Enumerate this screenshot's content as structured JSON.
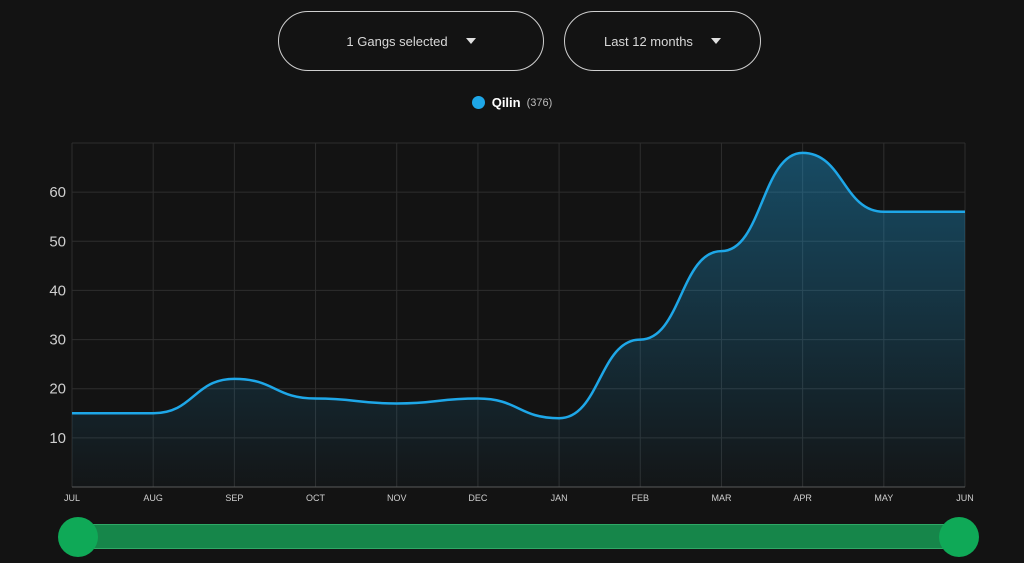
{
  "filters": {
    "gangs_label": "1 Gangs selected",
    "period_label": "Last 12 months"
  },
  "legend": {
    "name": "Qilin",
    "count": "(376)"
  },
  "colors": {
    "series": "#1ea7e8",
    "background": "#131313",
    "grid": "#2e2e2e",
    "slider": "#16864a",
    "slider_handle": "#0fa957"
  },
  "range_slider": {
    "start_fraction": 0,
    "end_fraction": 1
  },
  "chart_data": {
    "type": "area",
    "title": "",
    "xlabel": "",
    "ylabel": "",
    "categories": [
      "JUL",
      "AUG",
      "SEP",
      "OCT",
      "NOV",
      "DEC",
      "JAN",
      "FEB",
      "MAR",
      "APR",
      "MAY",
      "JUN"
    ],
    "series": [
      {
        "name": "Qilin",
        "values": [
          15,
          15,
          22,
          18,
          17,
          18,
          14,
          30,
          48,
          68,
          56,
          56
        ]
      }
    ],
    "ylim": [
      0,
      70
    ],
    "yticks": [
      10,
      20,
      30,
      40,
      50,
      60
    ],
    "grid": true,
    "legend_position": "top-center",
    "smooth": true
  }
}
